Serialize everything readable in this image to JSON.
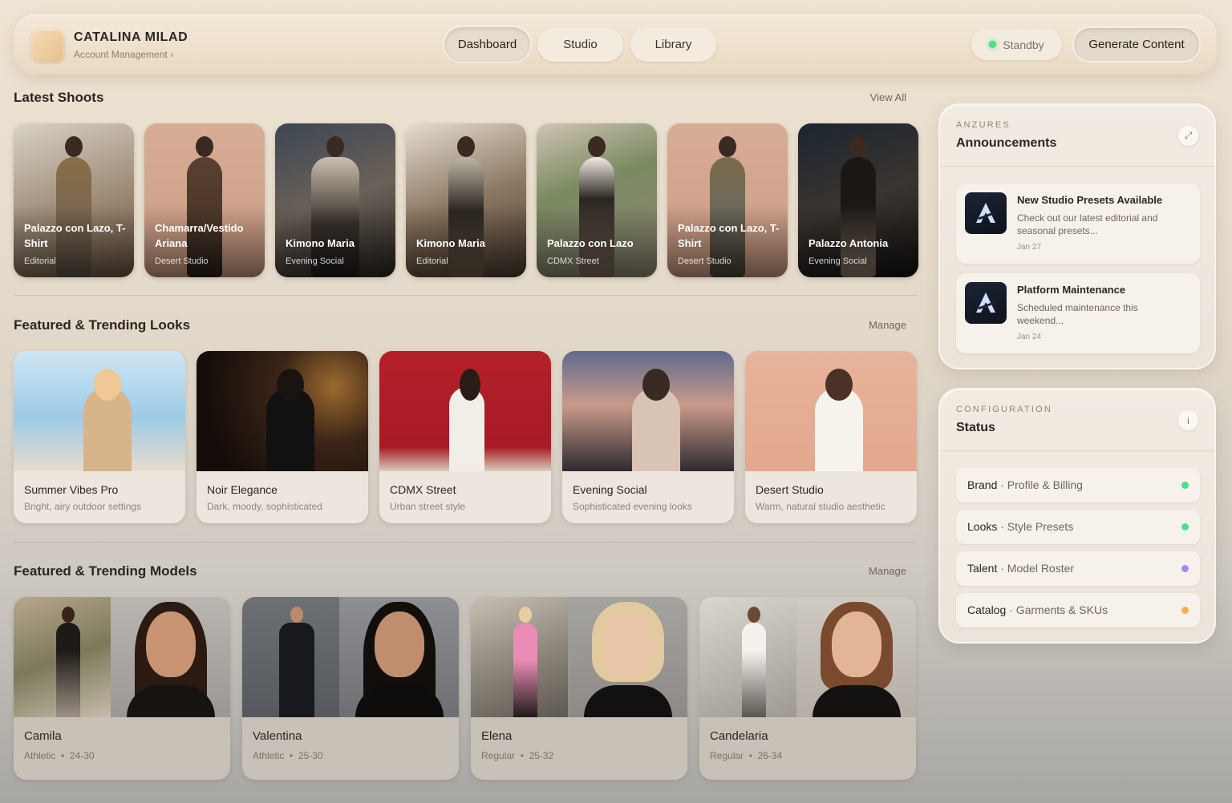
{
  "account": {
    "name": "CATALINA MILAD",
    "subtitle": "Account Management ›"
  },
  "nav": {
    "dashboard": "Dashboard",
    "studio": "Studio",
    "library": "Library"
  },
  "status_pill": {
    "label": "Standby",
    "dot_color": "#4ddf8a"
  },
  "generate_button": "Generate Content",
  "latest_shoots": {
    "title": "Latest Shoots",
    "link": "View All",
    "items": [
      {
        "title": "Palazzo con Lazo, T-Shirt",
        "subtitle": "Editorial"
      },
      {
        "title": "Chamarra/Vestido Ariana",
        "subtitle": "Desert Studio"
      },
      {
        "title": "Kimono Maria",
        "subtitle": "Evening Social"
      },
      {
        "title": "Kimono Maria",
        "subtitle": "Editorial"
      },
      {
        "title": "Palazzo con Lazo",
        "subtitle": "CDMX Street"
      },
      {
        "title": "Palazzo con Lazo, T-Shirt",
        "subtitle": "Desert Studio"
      },
      {
        "title": "Palazzo Antonia",
        "subtitle": "Evening Social"
      }
    ]
  },
  "looks": {
    "title": "Featured & Trending Looks",
    "link": "Manage",
    "items": [
      {
        "name": "Summer Vibes Pro",
        "desc": "Bright, airy outdoor settings"
      },
      {
        "name": "Noir Elegance",
        "desc": "Dark, moody, sophisticated"
      },
      {
        "name": "CDMX Street",
        "desc": "Urban street style"
      },
      {
        "name": "Evening Social",
        "desc": "Sophisticated evening looks"
      },
      {
        "name": "Desert Studio",
        "desc": "Warm, natural studio aesthetic"
      }
    ]
  },
  "models": {
    "title": "Featured & Trending Models",
    "link": "Manage",
    "items": [
      {
        "name": "Camila",
        "type": "Athletic",
        "age": "24-30"
      },
      {
        "name": "Valentina",
        "type": "Athletic",
        "age": "25-30"
      },
      {
        "name": "Elena",
        "type": "Regular",
        "age": "25-32"
      },
      {
        "name": "Candelaria",
        "type": "Regular",
        "age": "26-34"
      }
    ]
  },
  "announcements": {
    "eyebrow": "ANZURES",
    "title": "Announcements",
    "items": [
      {
        "title": "New Studio Presets Available",
        "text": "Check out our latest editorial and seasonal presets...",
        "date": "Jan 27"
      },
      {
        "title": "Platform Maintenance",
        "text": "Scheduled maintenance this weekend...",
        "date": "Jan 24"
      }
    ]
  },
  "configuration": {
    "eyebrow": "CONFIGURATION",
    "title": "Status",
    "items": [
      {
        "label": "Brand",
        "sub": " · Profile & Billing",
        "color": "#4ddf8a"
      },
      {
        "label": "Looks",
        "sub": " · Style Presets",
        "color": "#4ddf8a"
      },
      {
        "label": "Talent",
        "sub": " · Model Roster",
        "color": "#a58bf0"
      },
      {
        "label": "Catalog",
        "sub": " · Garments & SKUs",
        "color": "#f5b14a"
      }
    ]
  },
  "icons": {
    "expand": "expand-icon",
    "info": "info-icon",
    "brand_logo": "brand-logo-icon"
  }
}
